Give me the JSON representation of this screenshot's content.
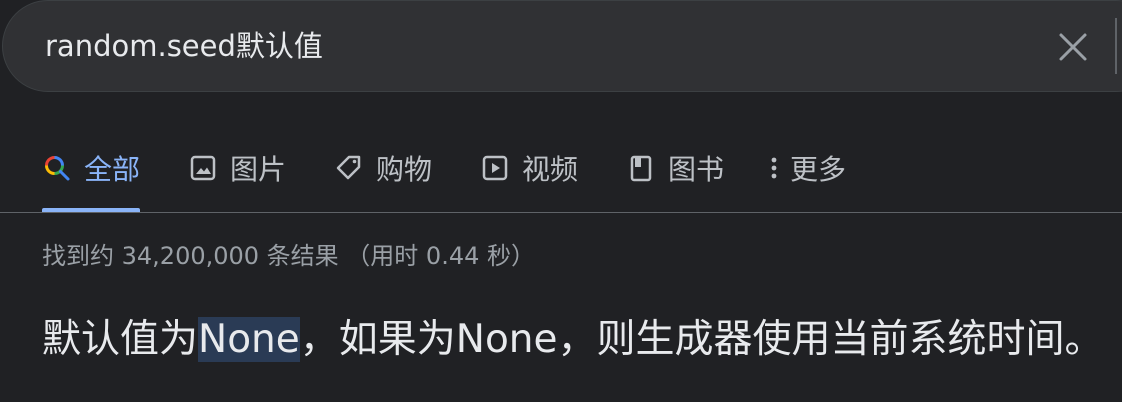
{
  "search": {
    "query": "random.seed默认值",
    "clear_icon": "close-icon"
  },
  "tabs": [
    {
      "label": "全部",
      "icon": "search-icon",
      "active": true
    },
    {
      "label": "图片",
      "icon": "image-icon",
      "active": false
    },
    {
      "label": "购物",
      "icon": "tag-icon",
      "active": false
    },
    {
      "label": "视频",
      "icon": "play-icon",
      "active": false
    },
    {
      "label": "图书",
      "icon": "book-icon",
      "active": false
    },
    {
      "label": "更多",
      "icon": "more-vert-icon",
      "active": false
    }
  ],
  "result_stats": "找到约 34,200,000 条结果 （用时 0.44 秒）",
  "snippet": {
    "before": "默认值为",
    "highlight": "None",
    "after": "，如果为None，则生成器使用当前系统时间。"
  },
  "colors": {
    "background": "#202124",
    "search_box": "#303134",
    "active_tab": "#8ab4f8",
    "tab_text": "#bdc1c6",
    "stats_text": "#9aa0a6",
    "highlight_bg": "#2a3b55"
  }
}
